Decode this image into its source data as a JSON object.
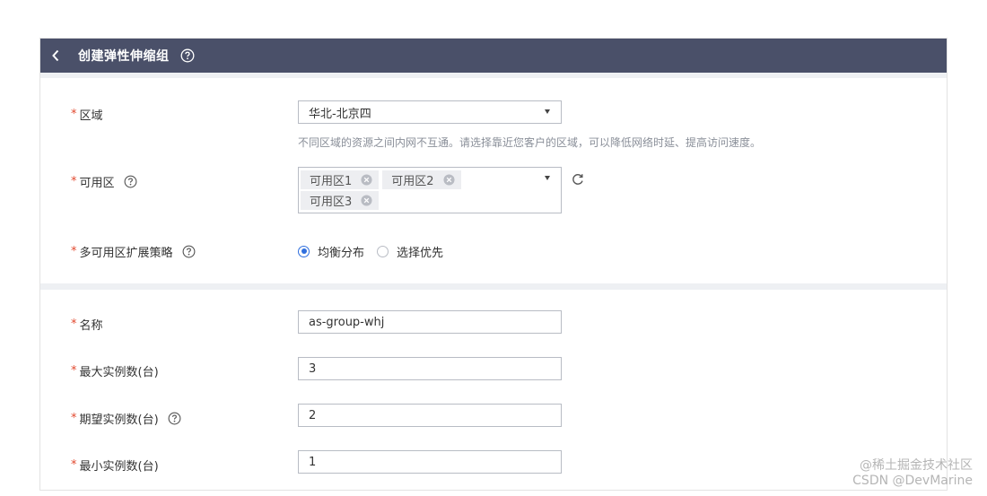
{
  "header": {
    "title": "创建弹性伸缩组"
  },
  "fields": {
    "region": {
      "label": "区域",
      "value": "华北-北京四",
      "hint": "不同区域的资源之间内网不互通。请选择靠近您客户的区域，可以降低网络时延、提高访问速度。"
    },
    "az": {
      "label": "可用区",
      "tags": [
        "可用区1",
        "可用区2",
        "可用区3"
      ]
    },
    "strategy": {
      "label": "多可用区扩展策略",
      "options": [
        "均衡分布",
        "选择优先"
      ],
      "selected": "均衡分布"
    },
    "name": {
      "label": "名称",
      "value": "as-group-whj"
    },
    "max": {
      "label": "最大实例数(台)",
      "value": "3"
    },
    "desired": {
      "label": "期望实例数(台)",
      "value": "2"
    },
    "min": {
      "label": "最小实例数(台)",
      "value": "1"
    }
  },
  "required_mark": "*",
  "watermark": {
    "line1": "@稀土掘金技术社区",
    "line2": "CSDN @DevMarine"
  },
  "colors": {
    "header_bg": "#4a5069",
    "required": "#e2492f",
    "radio_active": "#2f6fde",
    "section_divider": "#eef0f3"
  }
}
